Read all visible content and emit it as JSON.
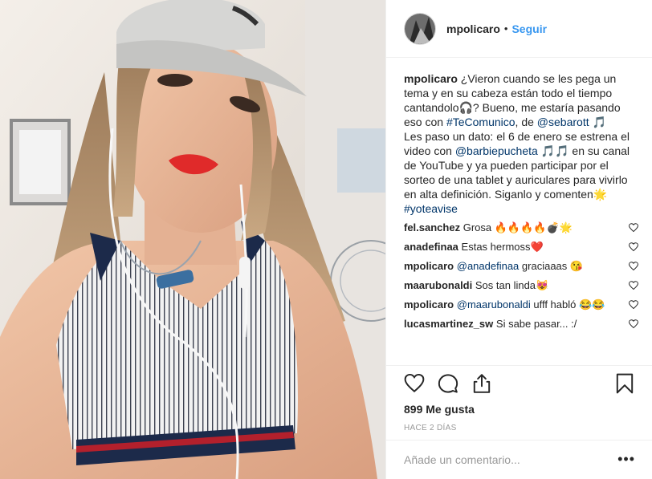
{
  "post": {
    "author": "mpolicaro",
    "header_separator": "•",
    "follow_label": "Seguir",
    "caption": {
      "user": "mpolicaro",
      "text1": "¿Vieron cuando se les pega un tema y en su cabeza están todo el tiempo cantandolo🎧? Bueno, me estaría pasando eso con ",
      "hashtag1": "#TeComunico",
      "text2": ", de ",
      "mention1": "@sebarott",
      "text3": " 🎵",
      "text4": "Les paso un dato: el 6 de enero se estrena el video con ",
      "mention2": "@barbiepucheta",
      "text5": " 🎵🎵 en su canal de YouTube y ya pueden participar por el sorteo de una tablet y auriculares para vivirlo en alta definición. Siganlo y comenten🌟",
      "hashtag2": "#yoteavise"
    },
    "comments": [
      {
        "user": "fel.sanchez",
        "text": "Grosa 🔥🔥🔥🔥💣🌟"
      },
      {
        "user": "anadefinaa",
        "text": "Estas hermoss❤️"
      },
      {
        "user": "mpolicaro",
        "mention": "@anadefinaa",
        "text": " graciaaas 😘"
      },
      {
        "user": "maarubonaldi",
        "text": "Sos tan linda😻"
      },
      {
        "user": "mpolicaro",
        "mention": "@maarubonaldi",
        "text": " ufff habló 😂😂"
      },
      {
        "user": "lucasmartinez_sw",
        "text": "Si sabe pasar... :/"
      }
    ],
    "icons": [
      "heart-outline-icon",
      "comment-icon",
      "share-icon",
      "bookmark-icon"
    ],
    "likes_text": "899 Me gusta",
    "time_ago": "HACE 2 DÍAS",
    "add_comment_placeholder": "Añade un comentario...",
    "more_options": "•••",
    "colors": {
      "link": "#003569",
      "follow": "#3897f0",
      "muted": "#999999"
    }
  }
}
